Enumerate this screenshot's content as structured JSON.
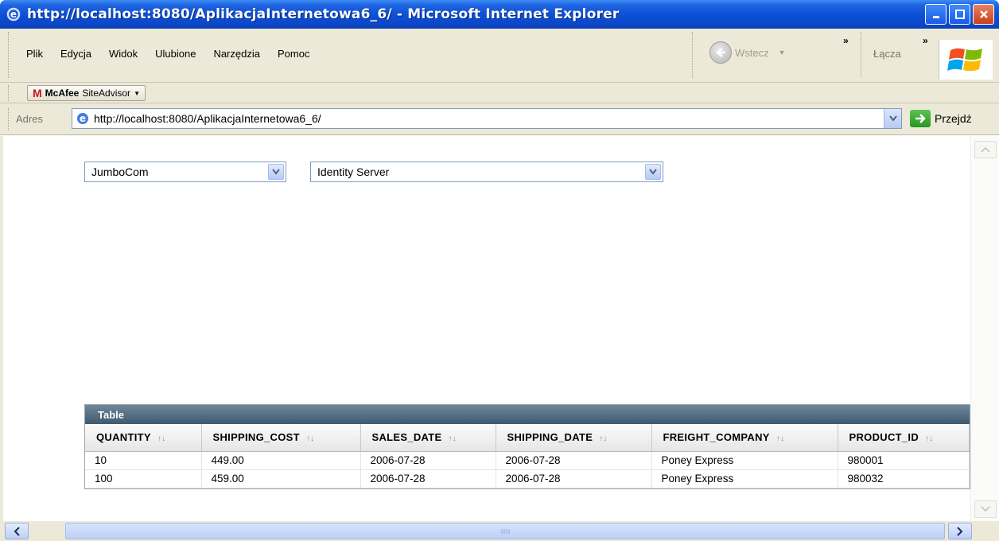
{
  "window": {
    "title": "http://localhost:8080/AplikacjaInternetowa6_6/ - Microsoft Internet Explorer"
  },
  "menu": {
    "items": [
      {
        "label": "Plik"
      },
      {
        "label": "Edycja"
      },
      {
        "label": "Widok"
      },
      {
        "label": "Ulubione"
      },
      {
        "label": "Narzędzia"
      },
      {
        "label": "Pomoc"
      }
    ],
    "back_label": "Wstecz",
    "links_label": "Łącza"
  },
  "toolbar": {
    "mcafee_brand": "McAfee",
    "mcafee_product": "SiteAdvisor"
  },
  "address": {
    "label": "Adres",
    "url": "http://localhost:8080/AplikacjaInternetowa6_6/",
    "go_label": "Przejdź"
  },
  "page": {
    "select_company": "JumboCom",
    "select_product": "Identity Server",
    "table_title": "Table",
    "columns": [
      "QUANTITY",
      "SHIPPING_COST",
      "SALES_DATE",
      "SHIPPING_DATE",
      "FREIGHT_COMPANY",
      "PRODUCT_ID"
    ],
    "rows": [
      [
        "10",
        "449.00",
        "2006-07-28",
        "2006-07-28",
        "Poney Express",
        "980001"
      ],
      [
        "100",
        "459.00",
        "2006-07-28",
        "2006-07-28",
        "Poney Express",
        "980032"
      ]
    ]
  },
  "icons": {
    "ie": "internet-explorer-icon",
    "back": "back-arrow-icon",
    "go": "go-arrow-icon",
    "sort": "sort-icon",
    "dropdown": "chevron-down-icon"
  },
  "colors": {
    "titlebar": "#0a4fd6",
    "chrome": "#ece9d8",
    "table_header": "#4f677c",
    "mcafee_red": "#c0171d"
  }
}
